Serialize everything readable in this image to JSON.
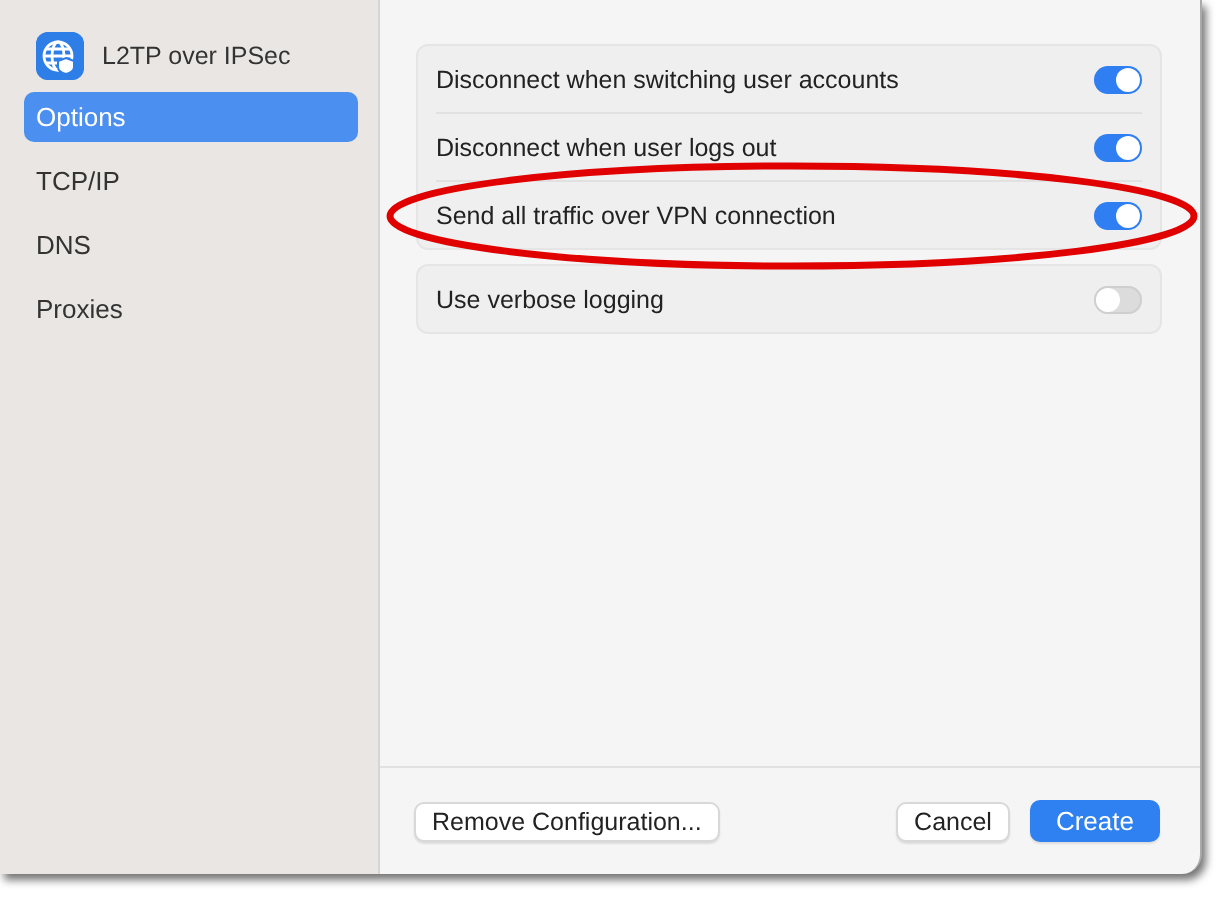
{
  "sidebar": {
    "title": "L2TP over IPSec",
    "items": [
      {
        "label": "Options",
        "selected": true
      },
      {
        "label": "TCP/IP",
        "selected": false
      },
      {
        "label": "DNS",
        "selected": false
      },
      {
        "label": "Proxies",
        "selected": false
      }
    ]
  },
  "groups": [
    {
      "rows": [
        {
          "label": "Disconnect when switching user accounts",
          "on": true
        },
        {
          "label": "Disconnect when user logs out",
          "on": true
        },
        {
          "label": "Send all traffic over VPN connection",
          "on": true
        }
      ]
    },
    {
      "rows": [
        {
          "label": "Use verbose logging",
          "on": false
        }
      ]
    }
  ],
  "annotation": {
    "kind": "ellipse"
  },
  "footer": {
    "left_button": "Remove Configuration...",
    "buttons": [
      {
        "label": "Cancel",
        "kind": "secondary"
      },
      {
        "label": "Create",
        "kind": "primary"
      }
    ]
  }
}
